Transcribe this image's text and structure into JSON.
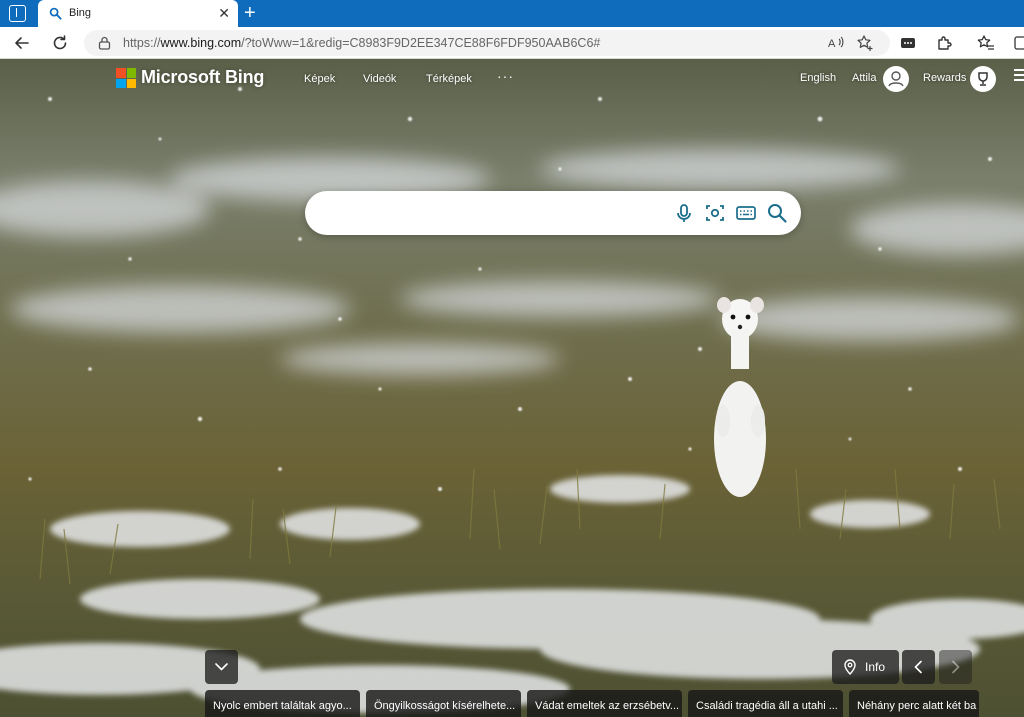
{
  "browser": {
    "tab_title": "Bing",
    "tab_close": "✕",
    "new_tab": "+",
    "url_prefix": "https://",
    "url_host": "www.bing.com",
    "url_path": "/?toWww=1&redig=C8983F9D2EE347CE88F6FDF950AAB6C6#",
    "accent_color": "#0f6cbd"
  },
  "header": {
    "brand": "Microsoft Bing",
    "nav": [
      "Képek",
      "Videók",
      "Térképek"
    ],
    "more": "···",
    "language": "English",
    "user_name": "Attila",
    "rewards_label": "Rewards"
  },
  "search": {
    "placeholder": "",
    "icons": [
      "microphone-icon",
      "visual-search-icon",
      "keyboard-icon",
      "search-icon"
    ]
  },
  "footer": {
    "info_label": "Info",
    "news": [
      "Nyolc embert találtak agyo...",
      "Öngyilkosságot kísérelhete...",
      "Vádat emeltek az erzsébetv...",
      "Családi tragédia áll a utahi ...",
      "Néhány perc alatt két ba"
    ]
  }
}
